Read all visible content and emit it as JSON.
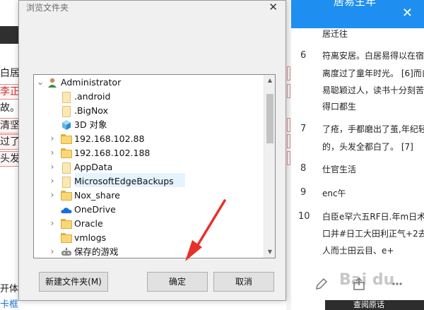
{
  "dialog": {
    "title": "浏览文件夹",
    "close_label": "✕",
    "tree": [
      {
        "label": "Administrator",
        "icon": "user-icon",
        "chevron": "⌄",
        "level": 0
      },
      {
        "label": ".android",
        "icon": "folder-icon",
        "chevron": "",
        "level": 1
      },
      {
        "label": ".BigNox",
        "icon": "folder-icon",
        "chevron": "",
        "level": 1
      },
      {
        "label": "3D 对象",
        "icon": "3d-objects-icon",
        "chevron": "",
        "level": 1
      },
      {
        "label": "192.168.102.88",
        "icon": "folder-icon",
        "chevron": "›",
        "level": 1
      },
      {
        "label": "192.168.102.188",
        "icon": "folder-icon",
        "chevron": "›",
        "level": 1
      },
      {
        "label": "AppData",
        "icon": "folder-icon",
        "chevron": "›",
        "level": 1
      },
      {
        "label": "MicrosoftEdgeBackups",
        "icon": "folder-icon",
        "chevron": "›",
        "level": 1
      },
      {
        "label": "Nox_share",
        "icon": "folder-icon",
        "chevron": "›",
        "level": 1
      },
      {
        "label": "OneDrive",
        "icon": "onedrive-icon",
        "chevron": "",
        "level": 1
      },
      {
        "label": "Oracle",
        "icon": "folder-icon",
        "chevron": "›",
        "level": 1
      },
      {
        "label": "vmlogs",
        "icon": "folder-icon",
        "chevron": "",
        "level": 1
      },
      {
        "label": "保存的游戏",
        "icon": "saved-games-icon",
        "chevron": "›",
        "level": 1
      }
    ],
    "buttons": {
      "new_folder": "新建文件夹(M)",
      "ok": "确定",
      "cancel": "取消"
    }
  },
  "background_left": {
    "fragments": [
      "白居",
      "李正",
      "故。",
      "清坚",
      "过了",
      "头发"
    ],
    "bottom_fragments": [
      "开体",
      "卡框"
    ]
  },
  "right_panel": {
    "header_title": "居易生年",
    "close_label": "✕",
    "items": [
      {
        "number": "",
        "lines": [
          "居迁往"
        ]
      },
      {
        "number": "6",
        "lines": [
          "符离安居。白居易得以在宿",
          "离度过了童年时光。 [6]而白",
          "易聪颖过人，读书十分刻苦",
          "得口都生"
        ]
      },
      {
        "number": "7",
        "lines": [
          "了疮，手都磨出了茧,年纪轻",
          "的，头发全都白了。 [7]"
        ]
      },
      {
        "number": "8",
        "lines": [
          "仕官生活"
        ]
      },
      {
        "number": "9",
        "lines": [
          "enc午"
        ]
      },
      {
        "number": "10",
        "lines": [
          "白臣e罕六五RF日.年m日术",
          "口并#日工大田利正气+2去",
          "人而士田云目、e+"
        ]
      }
    ],
    "bottom_tab": "查阅原话"
  },
  "watermark": "Bai du",
  "colors": {
    "accent_blue": "#1e8ff0",
    "arrow_red": "#e8302a",
    "folder_yellow": "#f8d775"
  }
}
